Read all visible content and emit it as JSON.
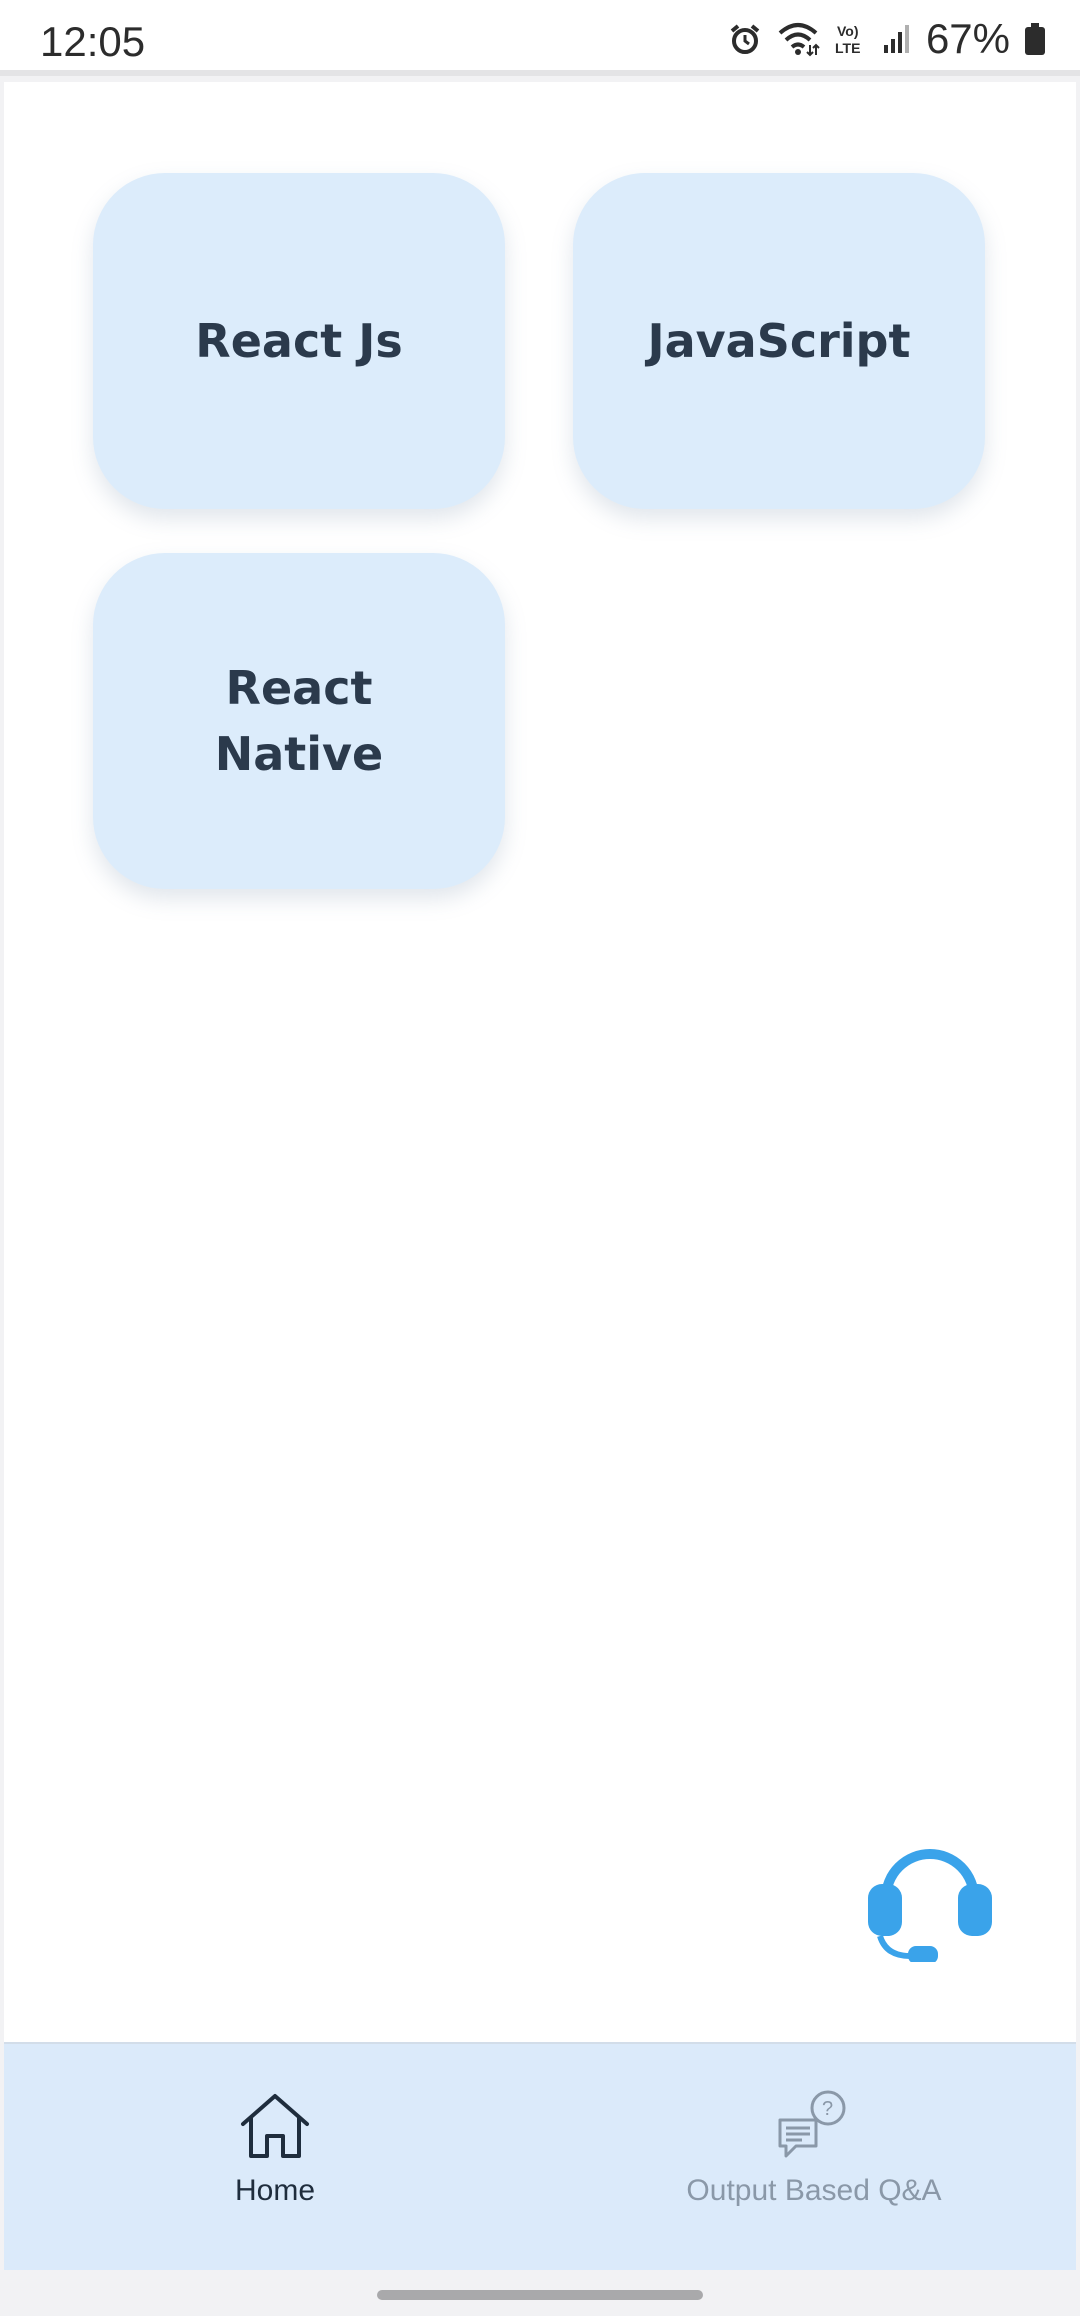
{
  "status_bar": {
    "time": "12:05",
    "battery": "67%",
    "icons": [
      "alarm-icon",
      "wifi-icon",
      "volte-icon",
      "signal-icon",
      "battery-icon"
    ]
  },
  "cards": [
    {
      "label": "React Js"
    },
    {
      "label": "JavaScript"
    },
    {
      "label": "React Native"
    }
  ],
  "support_button": {
    "icon": "headset-icon"
  },
  "bottom_nav": {
    "items": [
      {
        "label": "Home",
        "icon": "home-icon",
        "active": true
      },
      {
        "label": "Output Based Q&A",
        "icon": "chat-question-icon",
        "active": false
      }
    ]
  },
  "colors": {
    "card_bg": "#dcecfb",
    "card_text": "#2b3a4c",
    "nav_bg": "#dbeafa",
    "accent": "#3aa3ea",
    "inactive": "#8a98a8"
  }
}
